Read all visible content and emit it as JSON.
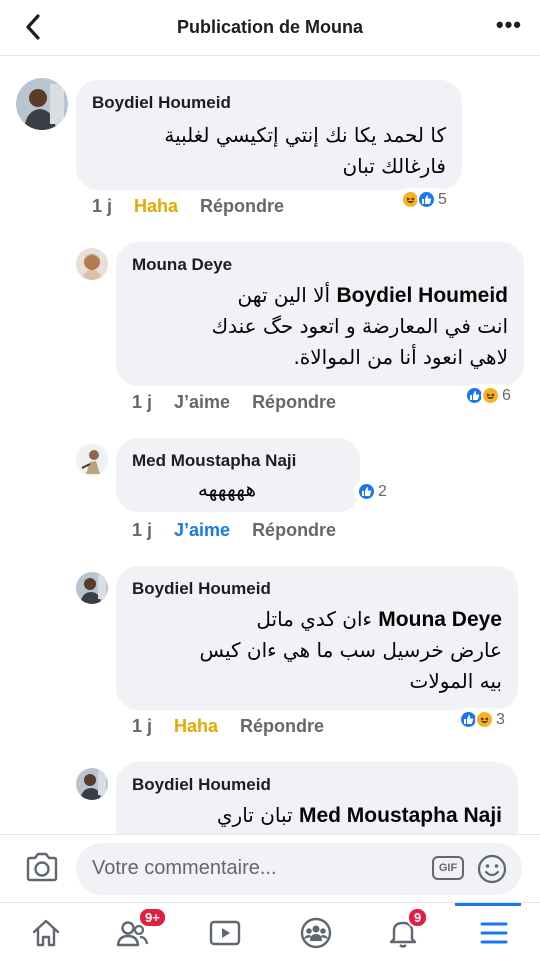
{
  "header": {
    "title": "Publication de Mouna"
  },
  "comments": [
    {
      "author": "Boydiel Houmeid",
      "mention": "",
      "text_lines": [
        "كا لحمد يكا نك إنتي إتكيسي لغلبية",
        "فارغالك تبان"
      ],
      "time": "1 j",
      "reaction_label": "Haha",
      "reply_label": "Répondre",
      "reaction_count": "5"
    },
    {
      "author": "Mouna Deye",
      "mention": "Boydiel Houmeid",
      "text_first": "ألا الين تهن",
      "text_lines": [
        "انت في المعارضة و اتعود حگ عندك",
        "لاهي انعود أنا من الموالاة."
      ],
      "time": "1 j",
      "reaction_label": "J’aime",
      "reply_label": "Répondre",
      "reaction_count": "6"
    },
    {
      "author": "Med Moustapha Naji",
      "mention": "",
      "text_lines": [
        "هههههه"
      ],
      "time": "1 j",
      "reaction_label": "J’aime",
      "reply_label": "Répondre",
      "reaction_count": "2"
    },
    {
      "author": "Boydiel Houmeid",
      "mention": "Mouna Deye",
      "text_first": "ءان كدي ماتل",
      "text_lines": [
        "عارض خرسيل  سب ما هي ءان كيس",
        "بيه المولات"
      ],
      "time": "1 j",
      "reaction_label": "Haha",
      "reply_label": "Répondre",
      "reaction_count": "3"
    },
    {
      "author": "Boydiel Houmeid",
      "mention": "Med Moustapha Naji",
      "text_first": "تبان تاري",
      "text_lines": []
    }
  ],
  "composer": {
    "placeholder": "Votre commentaire...",
    "gif_label": "GIF"
  },
  "tabbar": {
    "friends_badge": "9+",
    "notifications_badge": "9"
  },
  "colors": {
    "accent": "#1877f2",
    "haha": "#e7a800",
    "bubble": "#f0f2f5",
    "badge": "#e41e3f"
  }
}
